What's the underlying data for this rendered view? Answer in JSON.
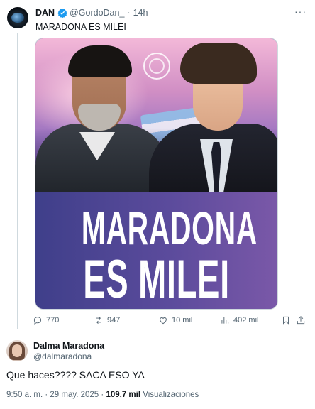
{
  "tweet1": {
    "display_name": "DAN",
    "handle": "@GordoDan_",
    "separator": "·",
    "time": "14h",
    "more_label": "···",
    "text": "MARADONA ES MILEI",
    "media": {
      "line1": "MARADONA",
      "line2": "ES MILEI"
    },
    "actions": {
      "replies": "770",
      "reposts": "947",
      "likes": "10 mil",
      "views": "402 mil"
    }
  },
  "tweet2": {
    "display_name": "Dalma Maradona",
    "handle": "@dalmaradona",
    "text": "Que haces???? SACA ESO YA",
    "time": "9:50 a. m.",
    "date": "29 may. 2025",
    "views_count": "109,7 mil",
    "views_label": "Visualizaciones"
  },
  "colors": {
    "verified": "#1d9bf0",
    "secondary_text": "#536471",
    "banner_left": "#3f3f8a",
    "banner_right": "#7a58a8"
  }
}
